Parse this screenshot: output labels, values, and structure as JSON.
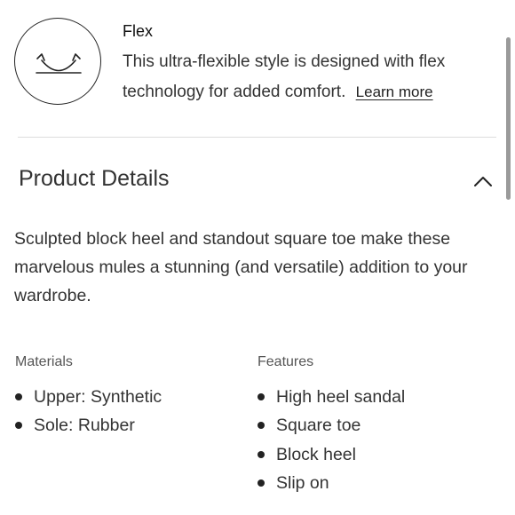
{
  "flex": {
    "icon": "flex-smile-icon",
    "title": "Flex",
    "description": "This ultra-flexible style is designed with flex technology for added comfort.",
    "learn_more": "Learn more"
  },
  "product_details": {
    "title": "Product Details",
    "toggle_icon": "chevron-up-icon",
    "description": "Sculpted block heel and standout square toe make these marvelous mules a stunning (and versatile) addition to your wardrobe.",
    "materials": {
      "heading": "Materials",
      "items": [
        "Upper: Synthetic",
        "Sole: Rubber"
      ]
    },
    "features": {
      "heading": "Features",
      "items": [
        "High heel sandal",
        "Square toe",
        "Block heel",
        "Slip on"
      ]
    }
  }
}
